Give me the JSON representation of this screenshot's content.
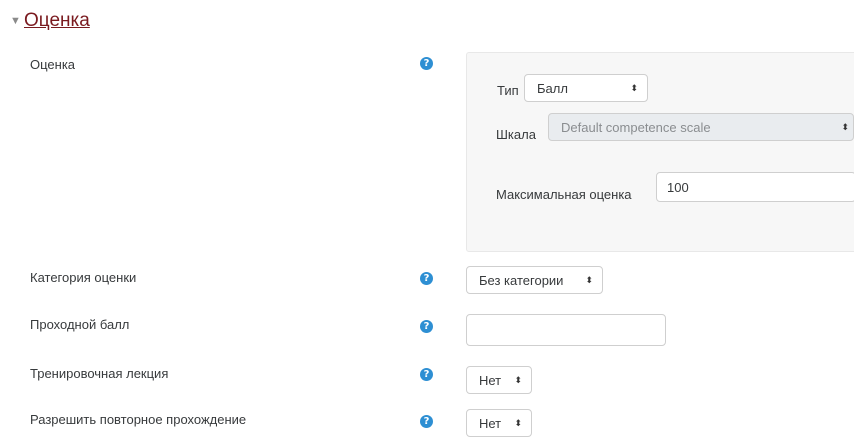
{
  "section": {
    "title": "Оценка",
    "caret_icon": "caret-down-icon"
  },
  "rows": {
    "grade": {
      "label": "Оценка"
    },
    "grade_category": {
      "label": "Категория оценки",
      "value": "Без категории"
    },
    "pass_grade": {
      "label": "Проходной балл",
      "value": ""
    },
    "practice": {
      "label": "Тренировочная лекция",
      "value": "Нет"
    },
    "retake": {
      "label": "Разрешить повторное прохождение",
      "value": "Нет"
    }
  },
  "grade_panel": {
    "type_label": "Тип",
    "type_value": "Балл",
    "scale_label": "Шкала",
    "scale_value": "Default competence scale",
    "max_label": "Максимальная оценка",
    "max_value": "100"
  },
  "icons": {
    "help": "?",
    "select_arrow": "⬍"
  },
  "colors": {
    "title": "#7a1a1f",
    "help": "#2e8fd3"
  }
}
